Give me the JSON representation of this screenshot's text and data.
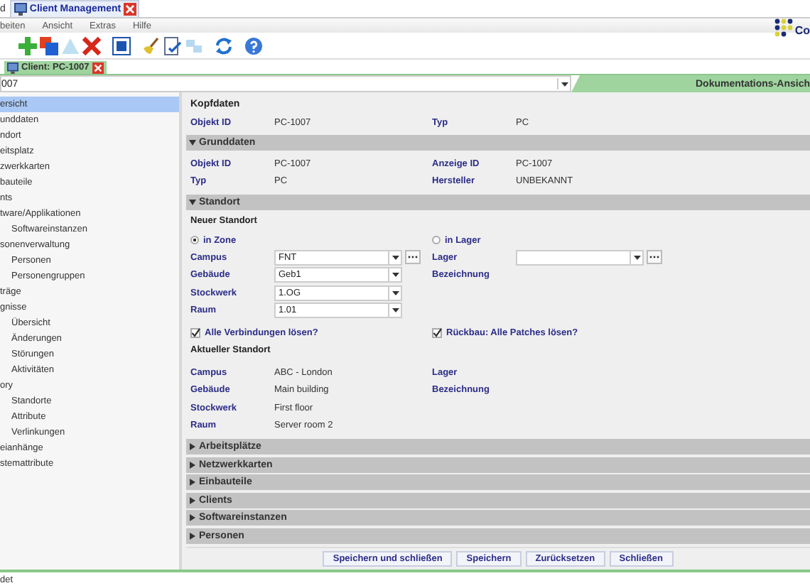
{
  "app_tabs": [
    {
      "label": "d",
      "selected": false,
      "closable": false
    },
    {
      "label": "Client Management",
      "selected": true,
      "closable": true
    }
  ],
  "menu": [
    "beiten",
    "Ansicht",
    "Extras",
    "Hilfe"
  ],
  "logo": {
    "text": "Co"
  },
  "doc_tabs": [
    {
      "label": "Client: PC-1007",
      "selected": true,
      "closable": true
    }
  ],
  "object_selector": {
    "value": "007"
  },
  "view_tab": {
    "label": "Dokumentations-Ansich",
    "selected": true
  },
  "sidebar": {
    "items": [
      {
        "label": "ersicht",
        "selected": true
      },
      {
        "label": "unddaten",
        "selected": false
      },
      {
        "label": "ndort",
        "selected": false
      },
      {
        "label": "eitsplatz",
        "selected": false
      },
      {
        "label": "zwerkkarten",
        "selected": false
      },
      {
        "label": "bauteile",
        "selected": false
      },
      {
        "label": "nts",
        "selected": false
      },
      {
        "label": "tware/Applikationen",
        "selected": false,
        "children": [
          {
            "label": "Softwareinstanzen",
            "selected": false
          }
        ]
      },
      {
        "label": "sonenverwaltung",
        "selected": false,
        "children": [
          {
            "label": "Personen",
            "selected": false
          },
          {
            "label": "Personengruppen",
            "selected": false
          }
        ]
      },
      {
        "label": "träge",
        "selected": false
      },
      {
        "label": "gnisse",
        "selected": false,
        "children": [
          {
            "label": "Übersicht",
            "selected": false
          },
          {
            "label": "Änderungen",
            "selected": false
          },
          {
            "label": "Störungen",
            "selected": false
          },
          {
            "label": "Aktivitäten",
            "selected": false
          }
        ]
      },
      {
        "label": "ory",
        "selected": false,
        "children": [
          {
            "label": "Standorte",
            "selected": false
          },
          {
            "label": "Attribute",
            "selected": false
          },
          {
            "label": "Verlinkungen",
            "selected": false
          }
        ]
      },
      {
        "label": "eianhänge",
        "selected": false
      },
      {
        "label": "stemattribute",
        "selected": false
      }
    ]
  },
  "kopfdaten": {
    "title": "Kopfdaten",
    "rows": [
      [
        {
          "label": "Objekt ID",
          "value": "PC-1007"
        },
        {
          "label": "Typ",
          "value": "PC"
        }
      ]
    ]
  },
  "grunddaten": {
    "title": "Grunddaten",
    "expanded": true,
    "rows": [
      [
        {
          "label": "Objekt ID",
          "value": "PC-1007"
        },
        {
          "label": "Anzeige ID",
          "value": "PC-1007"
        }
      ],
      [
        {
          "label": "Typ",
          "value": "PC"
        },
        {
          "label": "Hersteller",
          "value": "UNBEKANNT"
        }
      ]
    ]
  },
  "standort": {
    "title": "Standort",
    "expanded": true,
    "new_title": "Neuer Standort",
    "radios": [
      {
        "label": "in Zone",
        "selected": true
      },
      {
        "label": "in Lager",
        "selected": false
      }
    ],
    "zone_fields": [
      {
        "label": "Campus",
        "value": "FNT",
        "browse": true
      },
      {
        "label": "Gebäude",
        "value": "Geb1",
        "browse": false
      },
      {
        "label": "Stockwerk",
        "value": "1.OG",
        "browse": false
      },
      {
        "label": "Raum",
        "value": "1.01",
        "browse": false
      }
    ],
    "lager_fields": [
      {
        "label": "Lager",
        "kind": "combo",
        "browse": true
      },
      {
        "label": "Bezeichnung",
        "kind": "text"
      }
    ],
    "checkboxes": [
      {
        "label": "Alle Verbindungen lösen?",
        "checked": true
      },
      {
        "label": "Rückbau: Alle Patches lösen?",
        "checked": true
      }
    ],
    "current_title": "Aktueller Standort",
    "current_left": [
      {
        "label": "Campus",
        "value": "ABC - London"
      },
      {
        "label": "Gebäude",
        "value": "Main building"
      },
      {
        "label": "Stockwerk",
        "value": "First floor"
      },
      {
        "label": "Raum",
        "value": "Server room 2"
      }
    ],
    "current_right": [
      "Lager",
      "Bezeichnung"
    ]
  },
  "collapsed_sections": [
    {
      "title": "Arbeitsplätze",
      "expanded": false
    },
    {
      "title": "Netzwerkkarten",
      "expanded": false
    },
    {
      "title": "Einbauteile",
      "expanded": false
    },
    {
      "title": "Clients",
      "expanded": false
    },
    {
      "title": "Softwareinstanzen",
      "expanded": false
    },
    {
      "title": "Personen",
      "expanded": false
    }
  ],
  "buttons": [
    "Speichern und schließen",
    "Speichern",
    "Zurücksetzen",
    "Schließen"
  ],
  "status_bar": {
    "text": "det"
  }
}
